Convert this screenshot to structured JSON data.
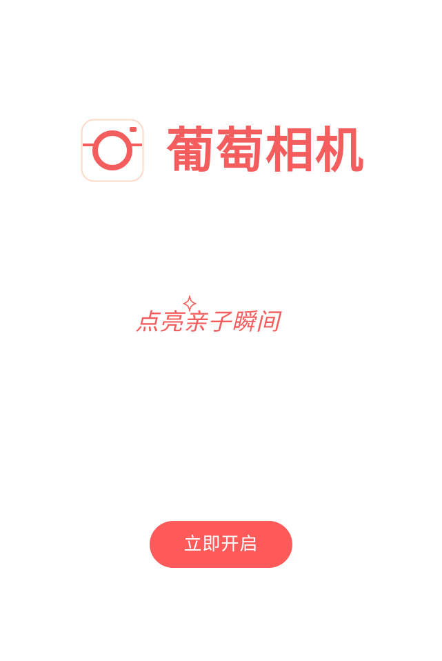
{
  "brand": {
    "app_name": "葡萄相机",
    "icon": "camera-icon",
    "accent_color": "#f45d5d",
    "icon_border_color": "#ffd9c6"
  },
  "tagline": {
    "text": "点亮亲子瞬间",
    "icon": "sparkle-icon"
  },
  "actions": {
    "start_label": "立即开启",
    "button_color": "#ff5a5a"
  }
}
